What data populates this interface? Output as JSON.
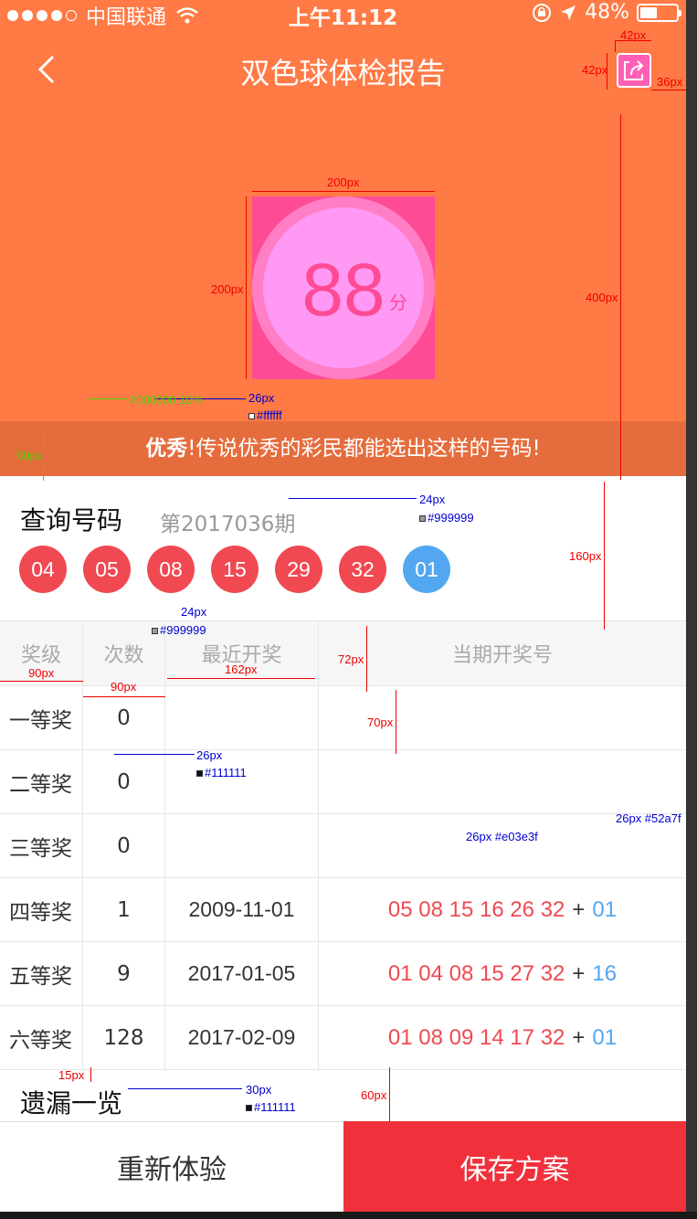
{
  "status_bar": {
    "carrier": "中国联通",
    "time": "上午11:12",
    "battery": "48%",
    "battery_level": 0.48
  },
  "nav": {
    "title": "双色球体检报告"
  },
  "score": {
    "value": "88",
    "unit": "分"
  },
  "banner": {
    "bold": "优秀",
    "text": "!传说优秀的彩民都能选出这样的号码!"
  },
  "query": {
    "title": "查询号码",
    "issue": "第2017036期",
    "red_balls": [
      "04",
      "05",
      "08",
      "15",
      "29",
      "32"
    ],
    "blue_ball": "01"
  },
  "table": {
    "headers": [
      "奖级",
      "次数",
      "最近开奖",
      "当期开奖号"
    ],
    "rows": [
      {
        "level": "一等奖",
        "count": "0",
        "date": "",
        "red": "",
        "blue": ""
      },
      {
        "level": "二等奖",
        "count": "0",
        "date": "",
        "red": "",
        "blue": ""
      },
      {
        "level": "三等奖",
        "count": "0",
        "date": "",
        "red": "",
        "blue": ""
      },
      {
        "level": "四等奖",
        "count": "1",
        "date": "2009-11-01",
        "red": "05 08 15 16 26 32",
        "blue": "01"
      },
      {
        "level": "五等奖",
        "count": "9",
        "date": "2017-01-05",
        "red": "01 04 08 15 27 32",
        "blue": "16"
      },
      {
        "level": "六等奖",
        "count": "128",
        "date": "2017-02-09",
        "red": "01 08 09 14 17 32",
        "blue": "01"
      }
    ]
  },
  "plus_sign": "+",
  "missing": {
    "title": "遗漏一览"
  },
  "footer": {
    "retry_label": "重新体验",
    "save_label": "保存方案"
  },
  "annotations": {
    "a42w": "42px",
    "a42h": "42px",
    "a36": "36px",
    "a200w": "200px",
    "a200h": "200px",
    "a400": "400px",
    "a26_banner": "26px",
    "c_banner": "#ffffff",
    "green": "#000000 10%",
    "a60": "60px",
    "a24_issue": "24px",
    "c_issue": "#999999",
    "a160": "160px",
    "a24_head": "24px",
    "c_head": "#999999",
    "a90a": "90px",
    "a90b": "90px",
    "a162": "162px",
    "a72": "72px",
    "a70": "70px",
    "a26_row": "26px",
    "c_row": "#111111",
    "a26_red": "26px #e03e3f",
    "a26_blue": "26px #52a7f",
    "a15": "15px",
    "a30": "30px",
    "c_miss": "#111111",
    "a60b": "60px"
  },
  "colors": {
    "header": "#ff7a45",
    "red": "#f04952",
    "blue": "#52a7f0",
    "save": "#f0313c",
    "score_pink": "#ff4b94"
  }
}
